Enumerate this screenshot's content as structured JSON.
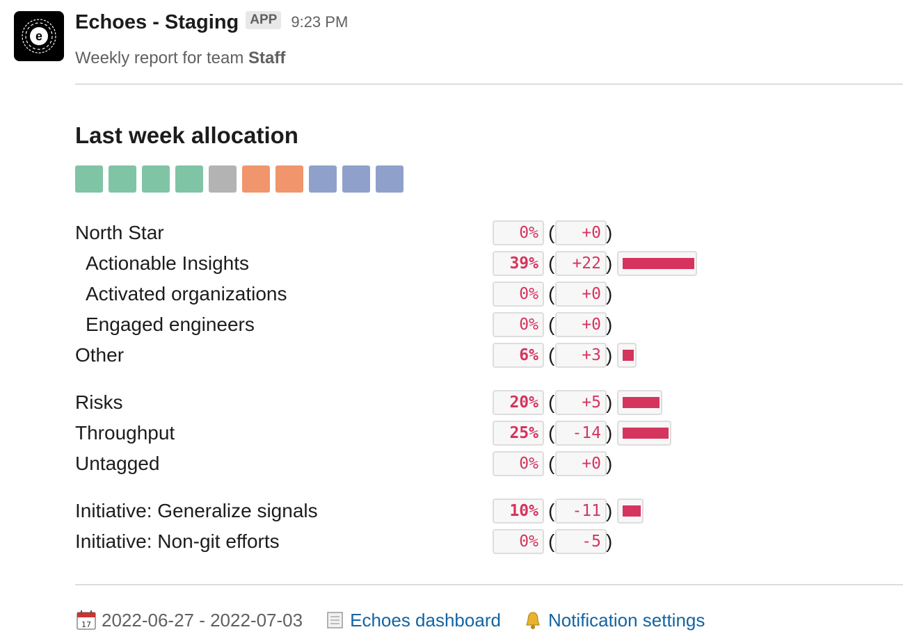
{
  "header": {
    "app_name": "Echoes - Staging",
    "badge": "APP",
    "time": "9:23 PM",
    "subtitle_prefix": "Weekly report for team ",
    "team": "Staff"
  },
  "section_title": "Last week allocation",
  "allocation_squares": [
    {
      "color": "#80c4a6"
    },
    {
      "color": "#80c4a6"
    },
    {
      "color": "#80c4a6"
    },
    {
      "color": "#80c4a6"
    },
    {
      "color": "#b3b3b3"
    },
    {
      "color": "#f0956c"
    },
    {
      "color": "#f0956c"
    },
    {
      "color": "#8fa1cb"
    },
    {
      "color": "#8fa1cb"
    },
    {
      "color": "#8fa1cb"
    }
  ],
  "rows": [
    {
      "label": "North Star",
      "percent": "0%",
      "delta": "+0",
      "value": 0
    },
    {
      "label": "Actionable Insights",
      "percent": "39%",
      "delta": "+22",
      "value": 39
    },
    {
      "label": "Activated organizations",
      "percent": "0%",
      "delta": "+0",
      "value": 0
    },
    {
      "label": "Engaged engineers",
      "percent": "0%",
      "delta": "+0",
      "value": 0
    },
    {
      "label": "Other",
      "percent": "6%",
      "delta": "+3",
      "value": 6
    },
    {
      "label": "Risks",
      "percent": "20%",
      "delta": "+5",
      "value": 20
    },
    {
      "label": "Throughput",
      "percent": "25%",
      "delta": "-14",
      "value": 25
    },
    {
      "label": "Untagged",
      "percent": "0%",
      "delta": "+0",
      "value": 0
    },
    {
      "label": "Initiative: Generalize signals",
      "percent": "10%",
      "delta": "-11",
      "value": 10
    },
    {
      "label": "Initiative: Non-git efforts",
      "percent": "0%",
      "delta": "-5",
      "value": 0
    }
  ],
  "footer": {
    "date_range": "2022-06-27 - 2022-07-03",
    "dashboard_link": "Echoes dashboard",
    "settings_link": "Notification settings",
    "icons": [
      "calendar-icon",
      "scroll-icon",
      "bell-icon"
    ]
  },
  "colors": {
    "accent": "#d5345e",
    "link": "#1264a3"
  }
}
